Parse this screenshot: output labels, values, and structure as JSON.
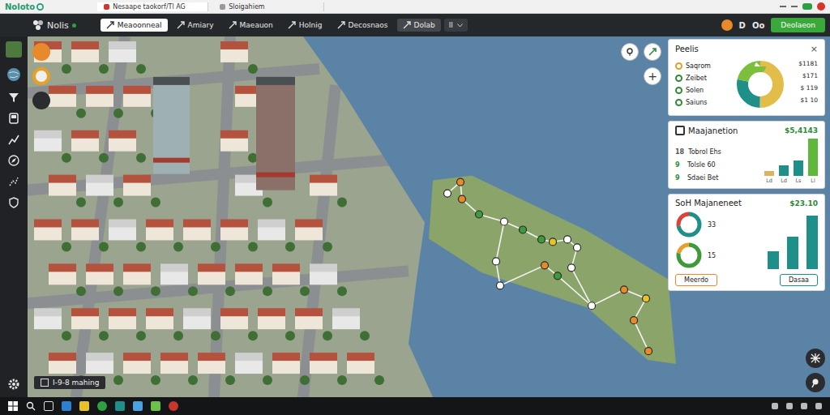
{
  "browser": {
    "logo": "Noloto",
    "tabs": [
      {
        "label": "Nesaape taokorf/Tl AG",
        "selected": true
      },
      {
        "label": "Sloigahiem",
        "selected": false
      }
    ]
  },
  "toolbar": {
    "app": "Nolis",
    "tabs": [
      {
        "label": "Meaoonneal",
        "selected": true
      },
      {
        "label": "Amiary",
        "selected": false
      },
      {
        "label": "Maeauon",
        "selected": false
      },
      {
        "label": "Holnig",
        "selected": false
      },
      {
        "label": "Decosnaos",
        "selected": false
      },
      {
        "label": "Dolab",
        "selected": false
      }
    ],
    "dropdown": "ll",
    "letter": "D",
    "letter2": "Oo",
    "action": "Deolaeon"
  },
  "map": {
    "zoom_in": "+",
    "label": "I-9-8 mahing",
    "pins": [
      {
        "color": "#e8892b"
      },
      {
        "color": "#ffffff"
      },
      {
        "color": "#e8892b"
      },
      {
        "color": "#3f9a3a"
      },
      {
        "color": "#ffffff"
      },
      {
        "color": "#3f9a3a"
      },
      {
        "color": "#3f9a3a"
      },
      {
        "color": "#e8c22b"
      },
      {
        "color": "#ffffff"
      },
      {
        "color": "#ffffff"
      },
      {
        "color": "#ffffff"
      },
      {
        "color": "#ffffff"
      },
      {
        "color": "#ffffff"
      },
      {
        "color": "#e8892b"
      },
      {
        "color": "#3f9a3a"
      },
      {
        "color": "#ffffff"
      },
      {
        "color": "#e8892b"
      },
      {
        "color": "#e8c22b"
      },
      {
        "color": "#e8892b"
      },
      {
        "color": "#e8892b"
      }
    ]
  },
  "peelis": {
    "title": "Peelis",
    "close": "×",
    "items": [
      {
        "label": "Saqrom",
        "value": "$1181",
        "color": "#e0a028"
      },
      {
        "label": "Zeibet",
        "value": "$171",
        "color": "#2f8a3a"
      },
      {
        "label": "Solen",
        "value": "$ 119",
        "color": "#2f8a3a"
      },
      {
        "label": "Saiuns",
        "value": "$1 10",
        "color": "#2f8a3a"
      }
    ],
    "donut": [
      {
        "value": 50,
        "color": "#e3bd4a"
      },
      {
        "value": 28,
        "color": "#1f8f8a"
      },
      {
        "value": 22,
        "color": "#7cbf3c"
      }
    ]
  },
  "maajanetion": {
    "title": "Maajanetion",
    "total": "$5,4143",
    "rows": [
      {
        "mark": "18",
        "label": "Tobrol Ehs",
        "color": "#555555"
      },
      {
        "mark": "9",
        "label": "Tolsle 60",
        "color": "#2f8a3a"
      },
      {
        "mark": "9",
        "label": "Sdaei Bet",
        "color": "#2f8a3a"
      }
    ],
    "bars": [
      {
        "value": 8,
        "label": "Ld",
        "color": "#d9b45a"
      },
      {
        "value": 16,
        "label": "Ld",
        "color": "#1f8f8a"
      },
      {
        "value": 24,
        "label": "Ls",
        "color": "#1f8f8a"
      },
      {
        "value": 58,
        "label": "Ll",
        "color": "#5fb83c"
      }
    ]
  },
  "soh": {
    "title": "SoH Majaneneet",
    "total": "$23.10",
    "gauges": [
      {
        "value": "33",
        "level": 0.72,
        "color": "#1f8f8a",
        "accent": "#d8443a"
      },
      {
        "value": "15",
        "level": 0.78,
        "color": "#3f9a3a",
        "accent": "#e8a02b"
      }
    ],
    "bars": [
      {
        "value": 30,
        "color": "#1f8f8a"
      },
      {
        "value": 55,
        "color": "#1f8f8a"
      },
      {
        "value": 90,
        "color": "#1f8f8a"
      }
    ],
    "buttons": [
      {
        "label": "Meerdo",
        "color": "#e8892b"
      },
      {
        "label": "Dasaa",
        "color": "#1f8f8a"
      }
    ]
  }
}
